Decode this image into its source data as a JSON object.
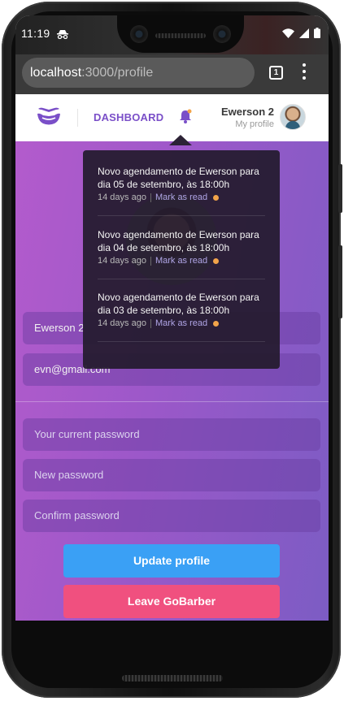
{
  "status": {
    "time": "11:19"
  },
  "browser": {
    "url_host": "localhost",
    "url_path": ":3000/profile",
    "tab_count": "1"
  },
  "header": {
    "dashboard_label": "DASHBOARD",
    "user_name": "Ewerson 2",
    "user_link": "My profile"
  },
  "notifications": [
    {
      "text": "Novo agendamento de Ewerson para dia 05 de setembro, às 18:00h",
      "time": "14 days ago",
      "action": "Mark as read"
    },
    {
      "text": "Novo agendamento de Ewerson para dia 04 de setembro, às 18:00h",
      "time": "14 days ago",
      "action": "Mark as read"
    },
    {
      "text": "Novo agendamento de Ewerson para dia 03 de setembro, às 18:00h",
      "time": "14 days ago",
      "action": "Mark as read"
    }
  ],
  "form": {
    "name_value": "Ewerson 2",
    "email_value": "evn@gmail.com",
    "current_password_placeholder": "Your current password",
    "new_password_placeholder": "New password",
    "confirm_password_placeholder": "Confirm password",
    "update_label": "Update profile",
    "leave_label": "Leave GoBarber"
  },
  "colors": {
    "brand_purple": "#7a4fc8",
    "update_button": "#3aa0f5",
    "leave_button": "#f0507f",
    "unread_dot": "#f2a44a"
  },
  "icons": [
    "incognito-icon",
    "wifi-icon",
    "signal-icon",
    "battery-icon",
    "tab-switcher-icon",
    "menu-dots-icon",
    "logo-icon",
    "bell-icon",
    "nav-back-icon",
    "nav-home-icon",
    "nav-recent-icon"
  ]
}
